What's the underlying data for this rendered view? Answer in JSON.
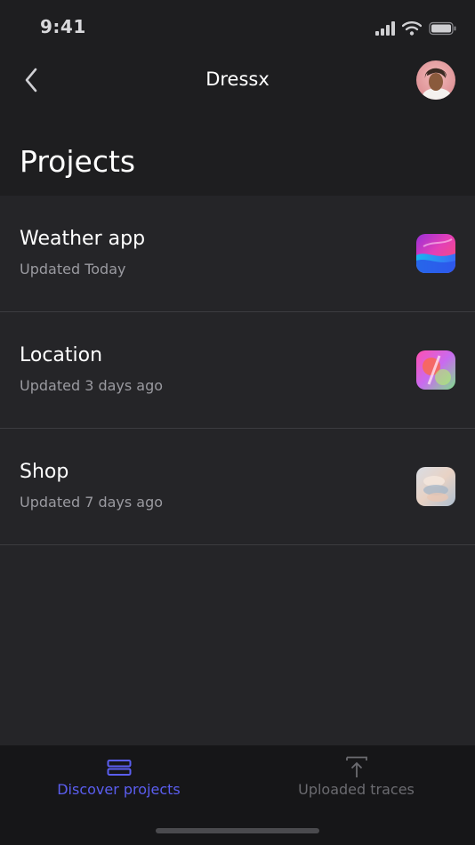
{
  "status_bar": {
    "time": "9:41"
  },
  "nav": {
    "title": "Dressx"
  },
  "page": {
    "title": "Projects"
  },
  "projects": [
    {
      "name": "Weather app",
      "updated": "Updated Today",
      "icon": "weather-app-icon"
    },
    {
      "name": "Location",
      "updated": "Updated 3 days ago",
      "icon": "location-app-icon"
    },
    {
      "name": "Shop",
      "updated": "Updated 7 days ago",
      "icon": "shop-app-icon"
    }
  ],
  "tabs": [
    {
      "label": "Discover projects",
      "icon": "stack-icon",
      "active": true
    },
    {
      "label": "Uploaded traces",
      "icon": "upload-icon",
      "active": false
    }
  ],
  "colors": {
    "accent": "#5b5ef0",
    "inactive": "#6b6b70",
    "background": "#1e1e20",
    "list_background": "#252528"
  }
}
